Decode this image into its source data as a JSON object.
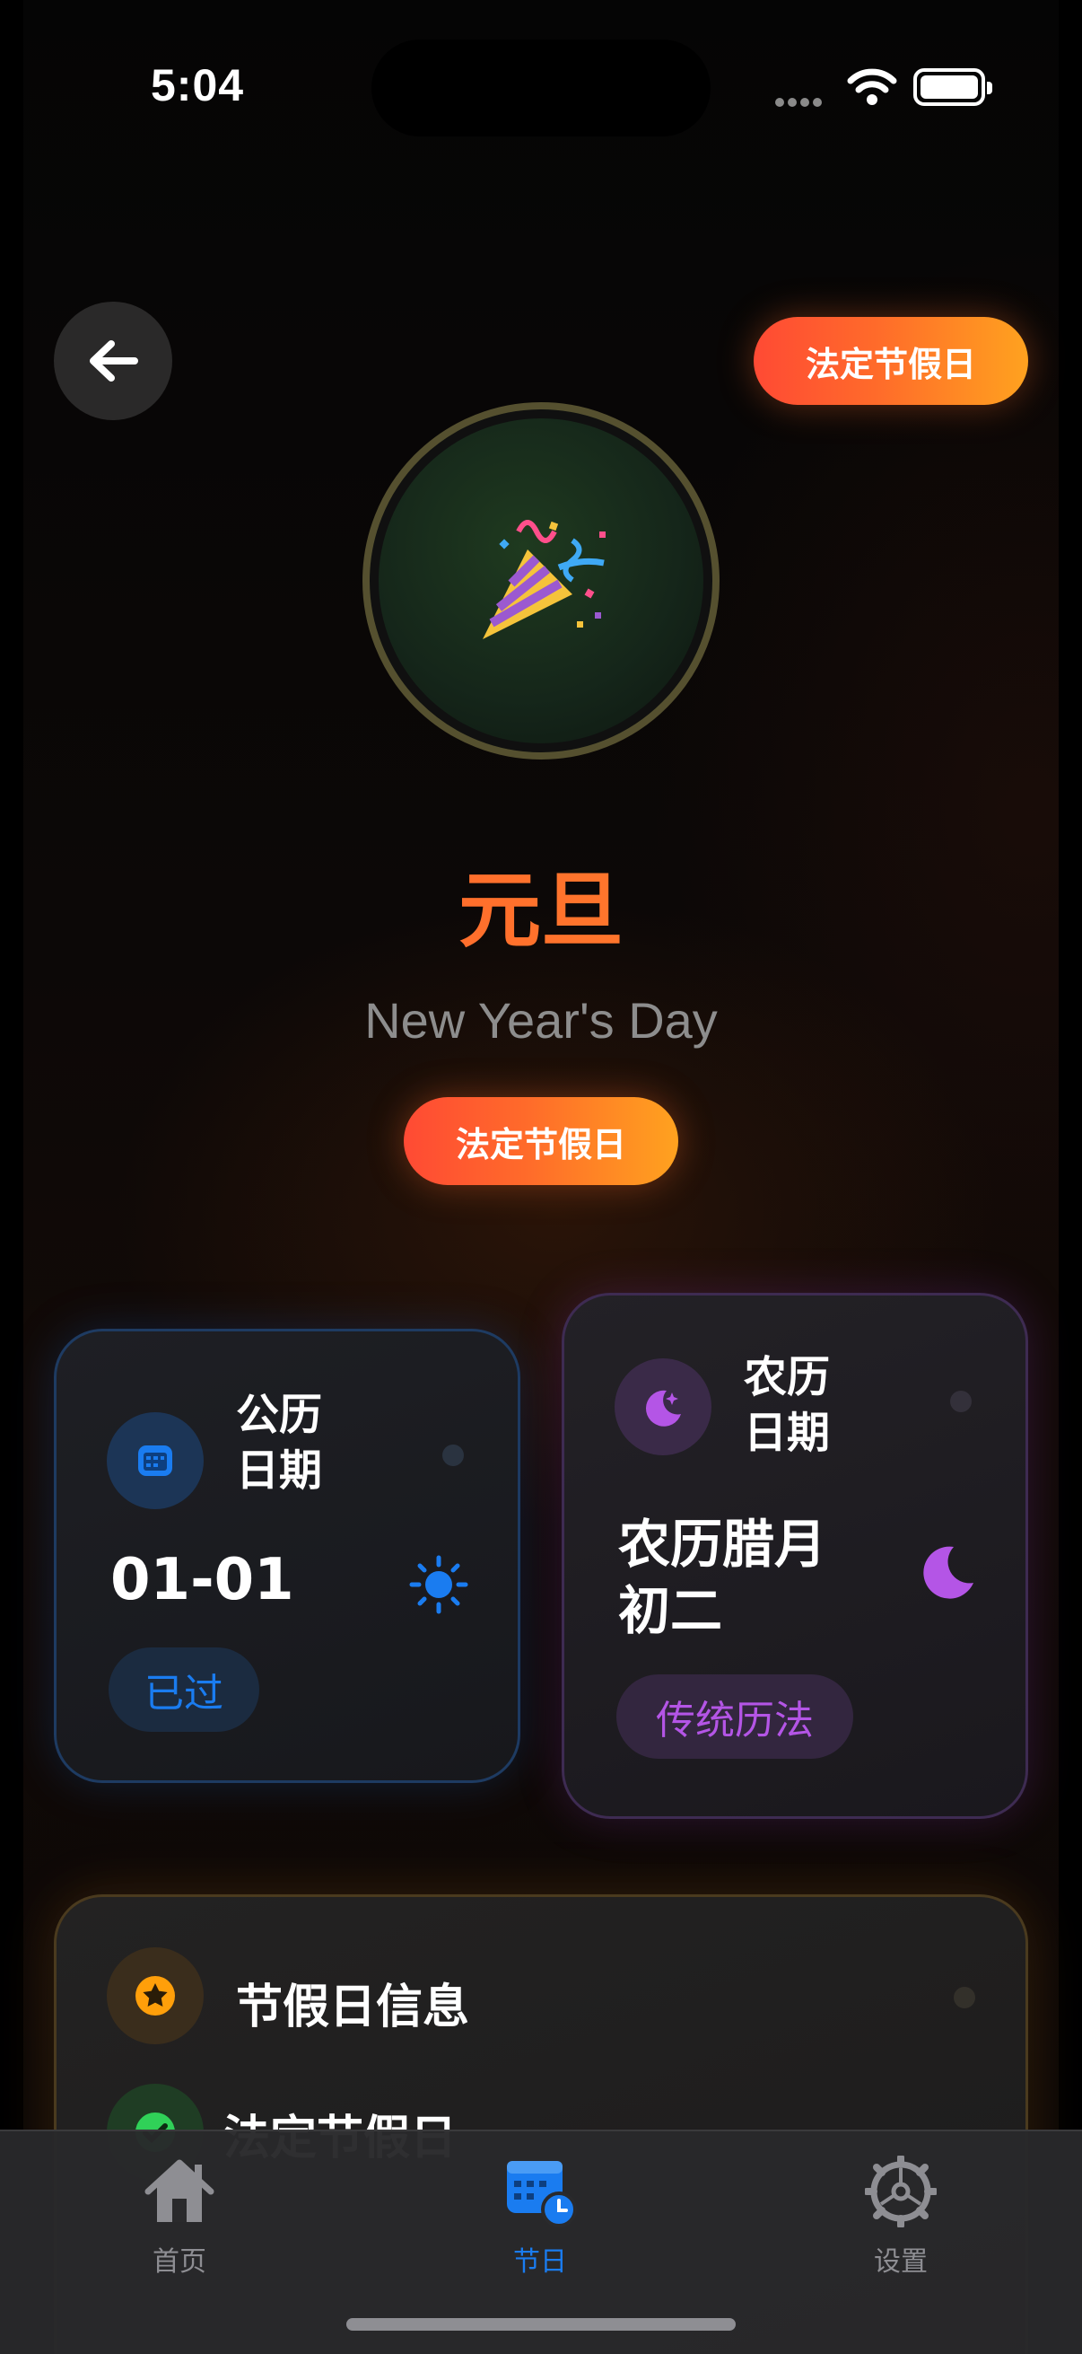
{
  "status_bar": {
    "time": "5:04"
  },
  "header": {
    "tag_top": "法定节假日"
  },
  "hero": {
    "emoji": "🎉",
    "title": "元旦",
    "subtitle": "New Year's Day",
    "tag": "法定节假日"
  },
  "solar_card": {
    "heading": "公历\n日期",
    "value": "01-01",
    "chip": "已过",
    "accent": "#1a7cf0"
  },
  "lunar_card": {
    "heading": "农历\n日期",
    "value": "农历腊月\n初二",
    "chip": "传统历法",
    "accent": "#b455e6"
  },
  "info_card": {
    "heading": "节假日信息",
    "row_label": "法定节假日",
    "accent": "#ff9f0a"
  },
  "tabbar": {
    "tabs": [
      {
        "label": "首页",
        "icon": "house-icon",
        "active": false
      },
      {
        "label": "节日",
        "icon": "calendar-clock-icon",
        "active": true
      },
      {
        "label": "设置",
        "icon": "gear-icon",
        "active": false
      }
    ],
    "active_color": "#1a7cf0",
    "inactive_color": "#8e8e93"
  }
}
